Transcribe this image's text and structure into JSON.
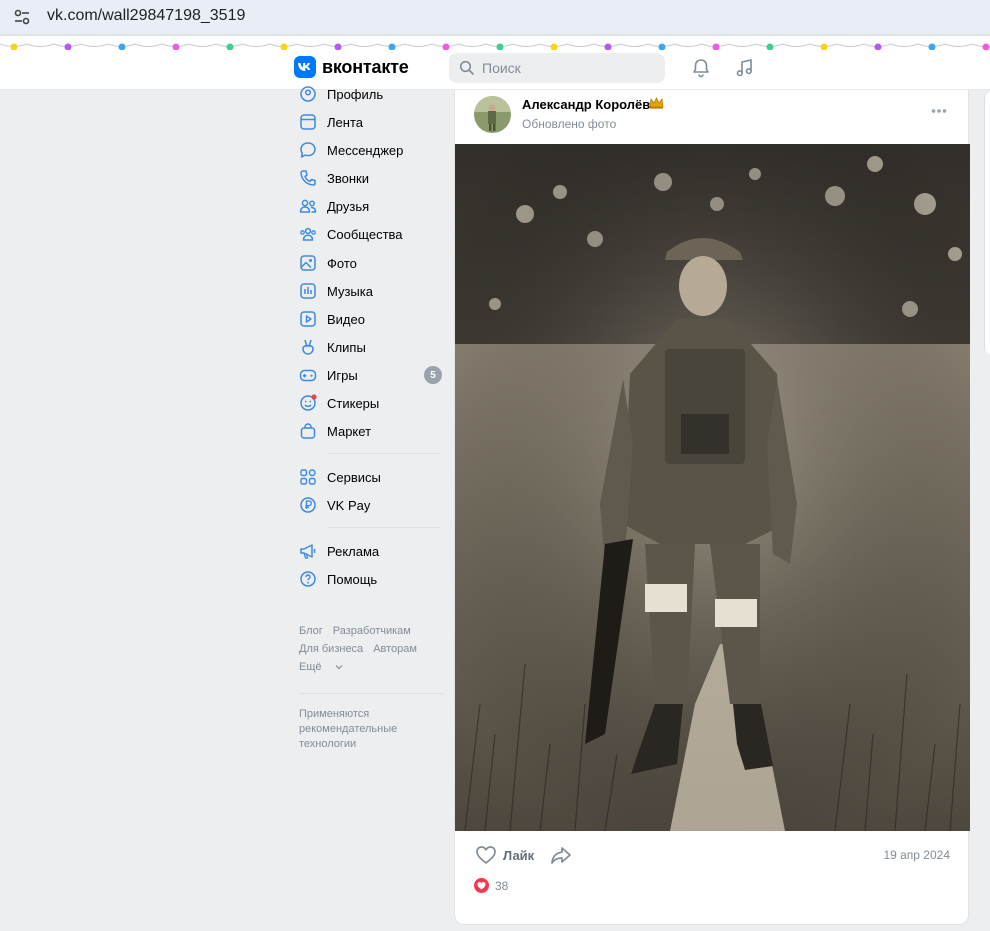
{
  "browser": {
    "url": "vk.com/wall29847198_3519",
    "site_icon": "tune-icon"
  },
  "header": {
    "logo_text": "вконтакте",
    "search_placeholder": "Поиск",
    "accent": "#0077ff"
  },
  "menu": {
    "items": [
      {
        "label": "Профиль",
        "icon": "profile-icon"
      },
      {
        "label": "Лента",
        "icon": "feed-icon"
      },
      {
        "label": "Мессенджер",
        "icon": "messenger-icon"
      },
      {
        "label": "Звонки",
        "icon": "phone-icon"
      },
      {
        "label": "Друзья",
        "icon": "friends-icon"
      },
      {
        "label": "Сообщества",
        "icon": "communities-icon"
      },
      {
        "label": "Фото",
        "icon": "photo-icon"
      },
      {
        "label": "Музыка",
        "icon": "music-icon"
      },
      {
        "label": "Видео",
        "icon": "video-icon"
      },
      {
        "label": "Клипы",
        "icon": "clips-icon"
      },
      {
        "label": "Игры",
        "icon": "games-icon",
        "badge": "5"
      },
      {
        "label": "Стикеры",
        "icon": "stickers-icon"
      },
      {
        "label": "Маркет",
        "icon": "market-icon"
      },
      {
        "label": "Сервисы",
        "icon": "services-icon"
      },
      {
        "label": "VK Pay",
        "icon": "vkpay-icon"
      },
      {
        "label": "Реклама",
        "icon": "ads-icon"
      },
      {
        "label": "Помощь",
        "icon": "help-icon"
      }
    ],
    "footer_links": [
      "Блог",
      "Разработчикам",
      "Для бизнеса",
      "Авторам",
      "Ещё"
    ],
    "note": "Применяются рекомендательные технологии"
  },
  "post": {
    "author": "Александр Королёв",
    "subtitle": "Обновлено фото",
    "like_label": "Лайк",
    "date": "19 апр 2024",
    "reactions_count": "38"
  }
}
